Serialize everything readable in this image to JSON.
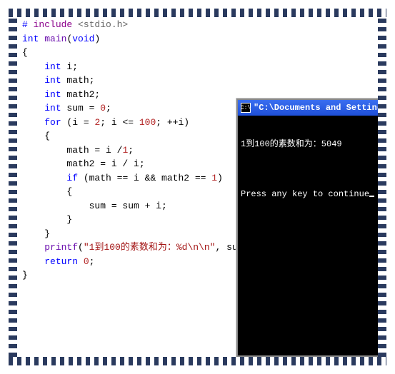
{
  "code": {
    "l1a": "# ",
    "l1b": "include",
    "l1c": " <stdio.h>",
    "l2": "",
    "l3a": "int",
    "l3b": " ",
    "l3c": "main",
    "l3d": "(",
    "l3e": "void",
    "l3f": ")",
    "l4": "{",
    "l5a": "    ",
    "l5b": "int",
    "l5c": " i;",
    "l6a": "    ",
    "l6b": "int",
    "l6c": " math;",
    "l7a": "    ",
    "l7b": "int",
    "l7c": " math2;",
    "l8a": "    ",
    "l8b": "int",
    "l8c": " sum = ",
    "l8d": "0",
    "l8e": ";",
    "l9": "",
    "l10a": "    ",
    "l10b": "for",
    "l10c": " (i = ",
    "l10d": "2",
    "l10e": "; i <= ",
    "l10f": "100",
    "l10g": "; ++i)",
    "l11": "    {",
    "l12a": "        math = i /",
    "l12b": "1",
    "l12c": ";",
    "l13": "        math2 = i / i;",
    "l14": "",
    "l15a": "        ",
    "l15b": "if",
    "l15c": " (math == i && math2 == ",
    "l15d": "1",
    "l15e": ")",
    "l16": "        {",
    "l17": "            sum = sum + i;",
    "l18": "        }",
    "l19": "    }",
    "l20": "",
    "l21a": "    ",
    "l21b": "printf",
    "l21c": "(",
    "l21d": "\"1到100的素数和为：%d\\n\\n\"",
    "l21e": ", sum);",
    "l22": "",
    "l23a": "    ",
    "l23b": "return",
    "l23c": " ",
    "l23d": "0",
    "l23e": ";",
    "l24": "}"
  },
  "console": {
    "sysicon": "C:\\",
    "title": "\"C:\\Documents and Settings",
    "line1": "1到100的素数和为：5049",
    "line2": "",
    "line3": "Press any key to continue"
  }
}
